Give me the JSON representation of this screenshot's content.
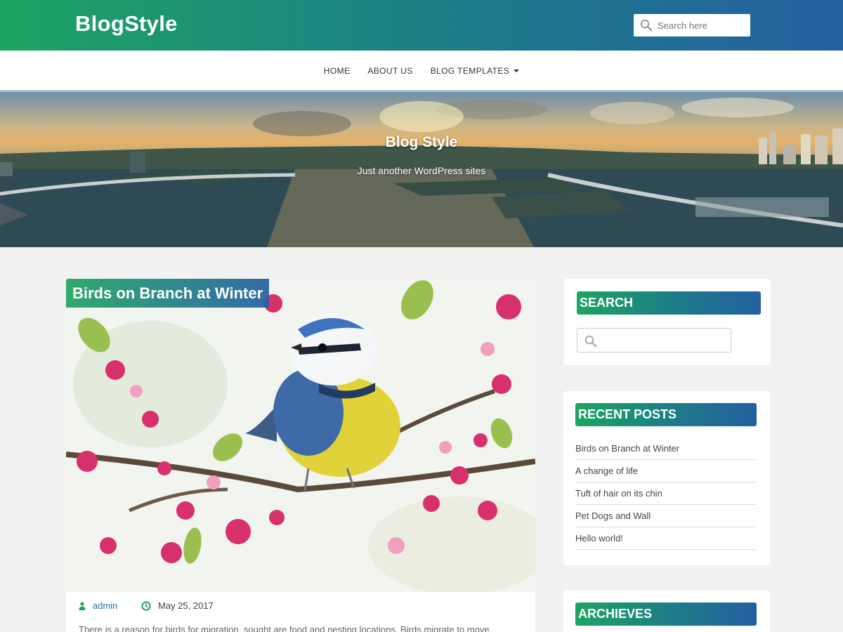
{
  "header": {
    "brand": "BlogStyle",
    "search_placeholder": "Search here"
  },
  "nav": {
    "items": [
      {
        "label": "HOME"
      },
      {
        "label": "ABOUT US"
      },
      {
        "label": "BLOG TEMPLATES",
        "has_dropdown": true
      }
    ]
  },
  "hero": {
    "title": "Blog Style",
    "subtitle": "Just another WordPress sites"
  },
  "post": {
    "title": "Birds on Branch at Winter",
    "author": "admin",
    "date": "May 25, 2017",
    "excerpt": "There is a reason for birds for migration, sought are food and nesting locations. Birds migrate to move"
  },
  "sidebar": {
    "search": {
      "title": "SEARCH",
      "placeholder": ""
    },
    "recent": {
      "title": "RECENT POSTS",
      "items": [
        "Birds on Branch at Winter",
        "A change of life",
        "Tuft of hair on its chin",
        "Pet Dogs and Wall",
        "Hello world!"
      ]
    },
    "archives": {
      "title": "ARCHIEVES"
    }
  },
  "colors": {
    "gradient_start": "#1da462",
    "gradient_end": "#245fa1",
    "page_bg": "#f1f1f1",
    "link": "#2c6d9e",
    "meta_icon": "#1da462"
  },
  "icons": {
    "search": "magnifier",
    "author": "user",
    "date": "clock"
  }
}
